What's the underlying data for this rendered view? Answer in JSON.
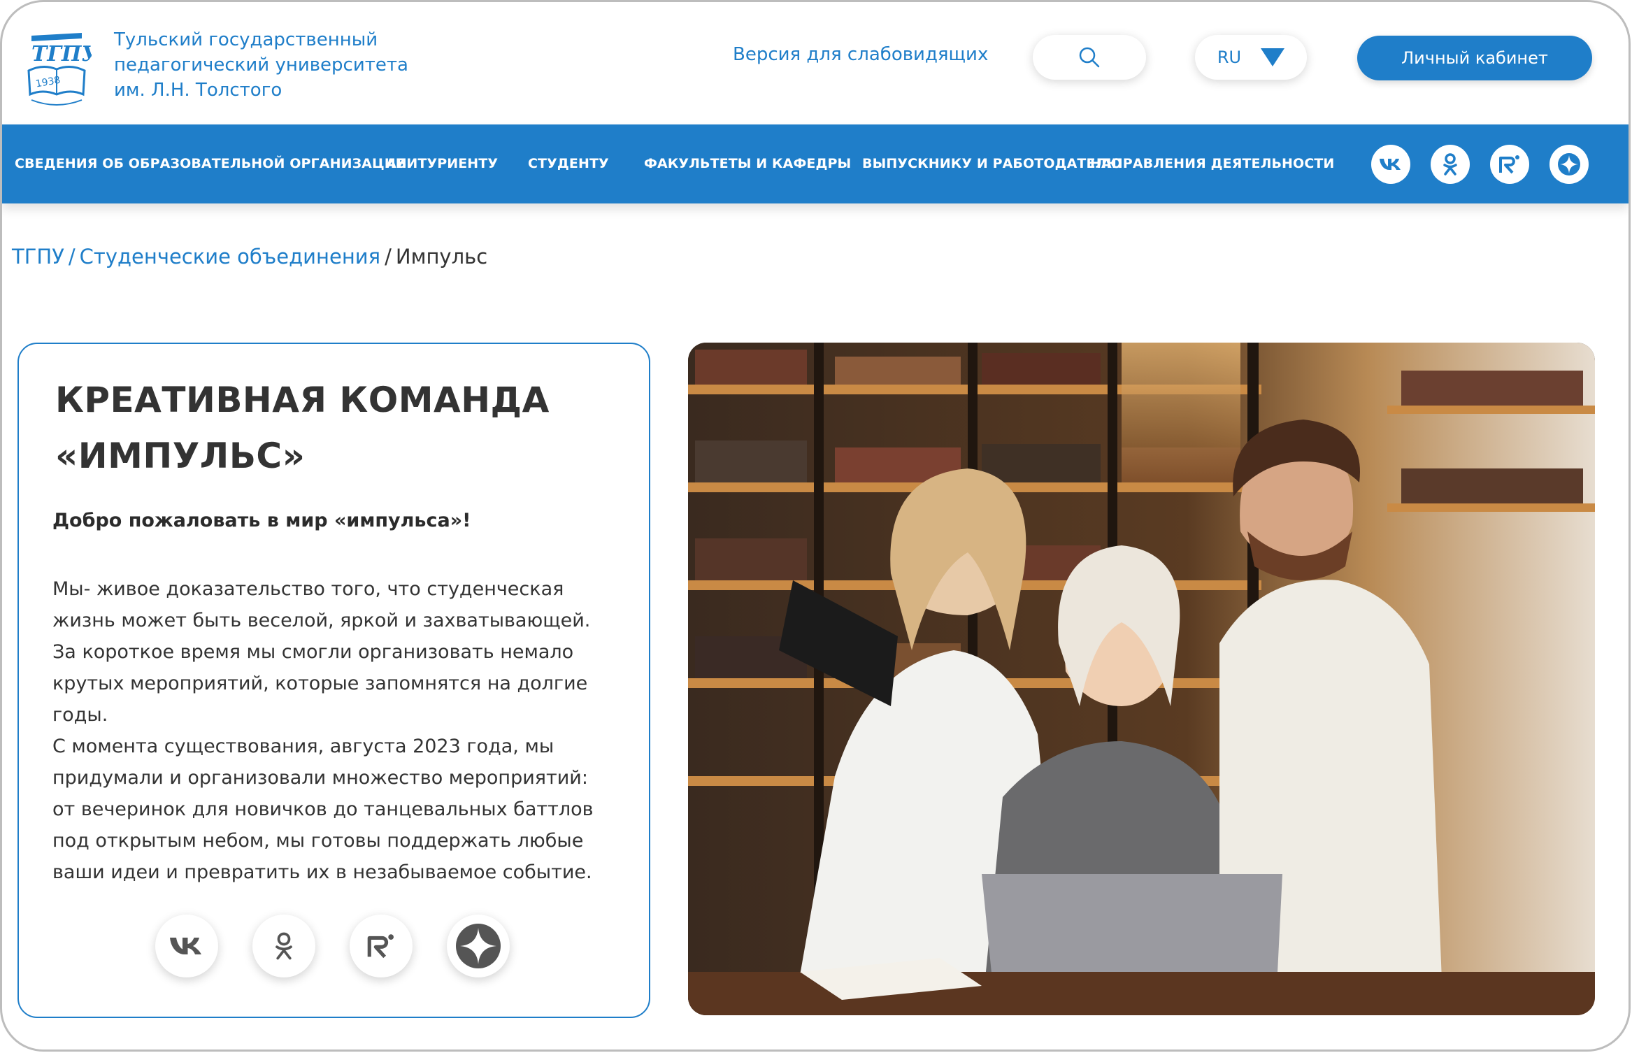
{
  "header": {
    "logo_text": "ТГПУ",
    "logo_year": "1938",
    "university_name": [
      "Тульский государственный",
      "педагогический университета",
      "им. Л.Н. Толстого"
    ],
    "low_vision_label": "Версия для слабовидящих",
    "search_icon": "search-icon",
    "language": "RU",
    "cabinet_label": "Личный кабинет"
  },
  "nav": {
    "items": [
      "СВЕДЕНИЯ ОБ ОБРАЗОВАТЕЛЬНОЙ ОРГАНИЗАЦИИ",
      "АБИТУРИЕНТУ",
      "СТУДЕНТУ",
      "ФАКУЛЬТЕТЫ И КАФЕДРЫ",
      "ВЫПУСКНИКУ И РАБОТОДАТЕЛЮ",
      "НАПРАВЛЕНИЯ ДЕЯТЕЛЬНОСТИ"
    ],
    "social_icons": [
      "vk-icon",
      "odnoklassniki-icon",
      "rutube-icon",
      "dzen-icon"
    ]
  },
  "breadcrumb": {
    "home": "ТГПУ",
    "section": "Студенческие объединения",
    "current": "Импульс",
    "separator": "/"
  },
  "card": {
    "title": [
      "КРЕАТИВНАЯ КОМАНДА",
      "«ИМПУЛЬС»"
    ],
    "subtitle": "Добро пожаловать в мир «импульса»!",
    "text_lines": [
      "Мы- живое доказательство того, что студенческая",
      "жизнь может быть веселой, яркой и захватывающей.",
      "За короткое время мы смогли организовать немало",
      "крутых мероприятий, которые запомнятся на долгие",
      "годы.",
      "С момента существования, августа 2023 года, мы",
      "придумали и организовали множество мероприятий:",
      "от вечеринок для новичков до танцевальных баттлов",
      "под открытым небом, мы готовы поддержать любые",
      "ваши идеи и превратить их в незабываемое событие."
    ],
    "social_icons": [
      "vk-icon",
      "odnoklassniki-icon",
      "rutube-icon",
      "dzen-icon"
    ]
  },
  "colors": {
    "brand_blue": "#1f7ec9",
    "text_dark": "#333333",
    "border_gray": "#bdbdbd"
  }
}
